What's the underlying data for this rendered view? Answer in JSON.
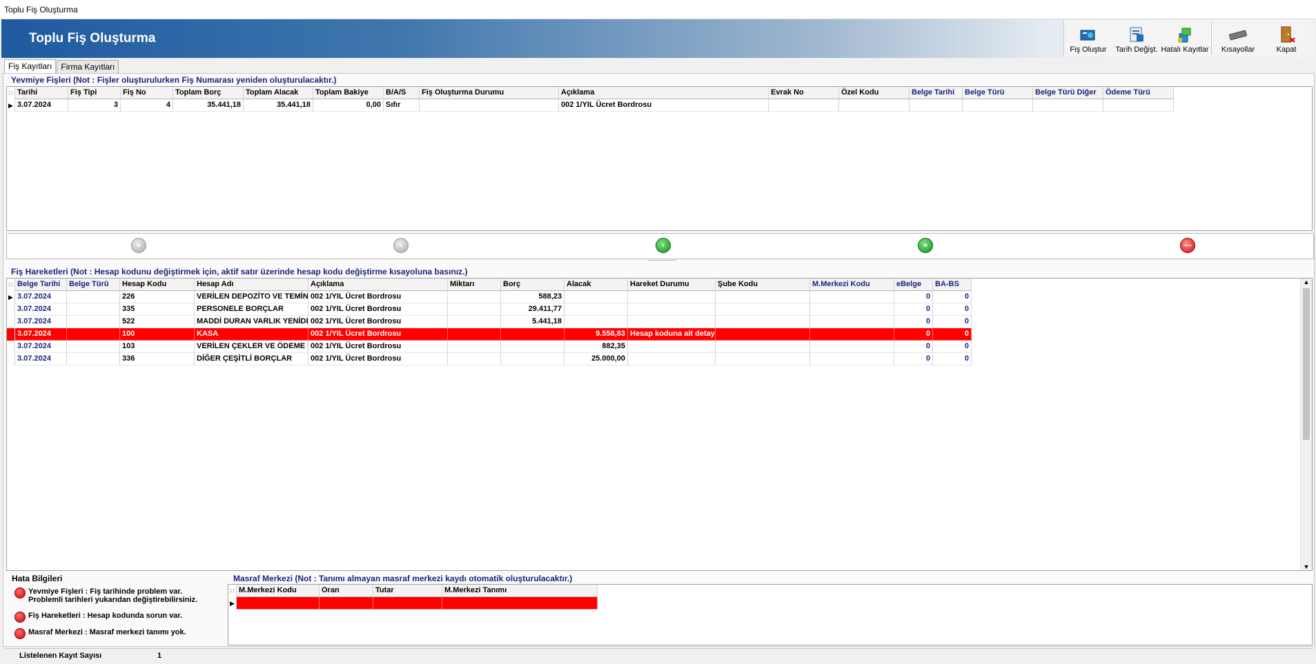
{
  "window": {
    "title": "Toplu Fiş Oluşturma"
  },
  "banner": {
    "title": "Toplu Fiş Oluşturma"
  },
  "toolbar": [
    {
      "label": "Fiş Oluştur",
      "icon": "create-voucher-icon"
    },
    {
      "label": "Tarih Değişt.",
      "icon": "change-date-icon"
    },
    {
      "label": "Hatalı Kayıtlar",
      "icon": "error-records-icon"
    },
    {
      "label": "Kısayollar",
      "icon": "keyboard-icon"
    },
    {
      "label": "Kapat",
      "icon": "exit-door-icon"
    }
  ],
  "tabs": [
    {
      "label": "Fiş Kayıtları",
      "active": true
    },
    {
      "label": "Firma Kayıtları",
      "active": false
    }
  ],
  "journal": {
    "title": "Yevmiye Fişleri (Not : Fişler oluşturulurken Fiş Numarası yeniden oluşturulacaktır.)",
    "columns": [
      "Tarihi",
      "Fiş Tipi",
      "Fiş No",
      "Toplam Borç",
      "Toplam Alacak",
      "Toplam Bakiye",
      "B/A/S",
      "Fiş Oluşturma Durumu",
      "Açıklama",
      "Evrak No",
      "Özel Kodu",
      "Belge Tarihi",
      "Belge Türü",
      "Belge Türü Diğer",
      "Ödeme Türü"
    ],
    "rows": [
      [
        "3.07.2024",
        "3",
        "4",
        "35.441,18",
        "35.441,18",
        "0,00",
        "Sıfır",
        "",
        "002 1/YIL Ücret Bordrosu",
        "",
        "",
        "",
        "",
        "",
        ""
      ]
    ]
  },
  "nav": [
    {
      "name": "first",
      "symbol": "«",
      "state": "off"
    },
    {
      "name": "prev",
      "symbol": "‹",
      "state": "off"
    },
    {
      "name": "next",
      "symbol": "›",
      "state": "on"
    },
    {
      "name": "last",
      "symbol": "»",
      "state": "on"
    },
    {
      "name": "stop",
      "symbol": "—",
      "state": "stop"
    }
  ],
  "movements": {
    "title": "Fiş Hareketleri (Not : Hesap kodunu değiştirmek için, aktif satır üzerinde hesap kodu değiştirme kısayoluna basınız.)",
    "columns": [
      "Belge Tarihi",
      "Belge Türü",
      "Hesap Kodu",
      "Hesap Adı",
      "Açıklama",
      "Miktarı",
      "Borç",
      "Alacak",
      "Hareket Durumu",
      "Şube Kodu",
      "M.Merkezi Kodu",
      "eBelge",
      "BA-BS"
    ],
    "rows": [
      [
        "3.07.2024",
        "",
        "226",
        "VERİLEN DEPOZİTO VE TEMİNATLAR",
        "002 1/YIL Ücret Bordrosu",
        "",
        "588,23",
        "",
        "",
        "",
        "",
        "0",
        "0"
      ],
      [
        "3.07.2024",
        "",
        "335",
        "PERSONELE BORÇLAR",
        "002 1/YIL Ücret Bordrosu",
        "",
        "29.411,77",
        "",
        "",
        "",
        "",
        "0",
        "0"
      ],
      [
        "3.07.2024",
        "",
        "522",
        "MADDİ DURAN VARLIK YENİDEN",
        "002 1/YIL Ücret Bordrosu",
        "",
        "5.441,18",
        "",
        "",
        "",
        "",
        "0",
        "0"
      ],
      [
        "3.07.2024",
        "",
        "100",
        "KASA",
        "002 1/YIL Ücret Bordrosu",
        "",
        "",
        "9.558,83",
        "Hesap koduna ait detay",
        "",
        "",
        "0",
        "0"
      ],
      [
        "3.07.2024",
        "",
        "103",
        "VERİLEN ÇEKLER VE ÖDEME EMİRLERİ",
        "002 1/YIL Ücret Bordrosu",
        "",
        "",
        "882,35",
        "",
        "",
        "",
        "0",
        "0"
      ],
      [
        "3.07.2024",
        "",
        "336",
        "DİĞER ÇEŞİTLİ BORÇLAR",
        "002 1/YIL Ücret Bordrosu",
        "",
        "",
        "25.000,00",
        "",
        "",
        "",
        "0",
        "0"
      ]
    ],
    "error_row": 3
  },
  "errors": {
    "title": "Hata Bilgileri",
    "items": [
      {
        "line1": "Yevmiye Fişleri : Fiş tarihinde problem var.",
        "line2": "Problemli tarihleri yukarıdan değiştirebilirsiniz."
      },
      {
        "line1": "Fiş Hareketleri : Hesap kodunda sorun var.",
        "line2": ""
      },
      {
        "line1": "Masraf Merkezi : Masraf merkezi tanımı yok.",
        "line2": ""
      }
    ]
  },
  "cost_center": {
    "title": "Masraf Merkezi (Not : Tanımı almayan masraf merkezi kaydı otomatik oluşturulacaktır.)",
    "columns": [
      "M.Merkezi Kodu",
      "Oran",
      "Tutar",
      "M.Merkezi Tanımı"
    ],
    "rows": [
      [
        "",
        "",
        "",
        ""
      ]
    ]
  },
  "status": {
    "label": "Listelenen Kayıt Sayısı",
    "value": "1"
  },
  "colors": {
    "error": "#ff0000",
    "header_text": "#1a237e",
    "banner": "#1f5aa0"
  }
}
